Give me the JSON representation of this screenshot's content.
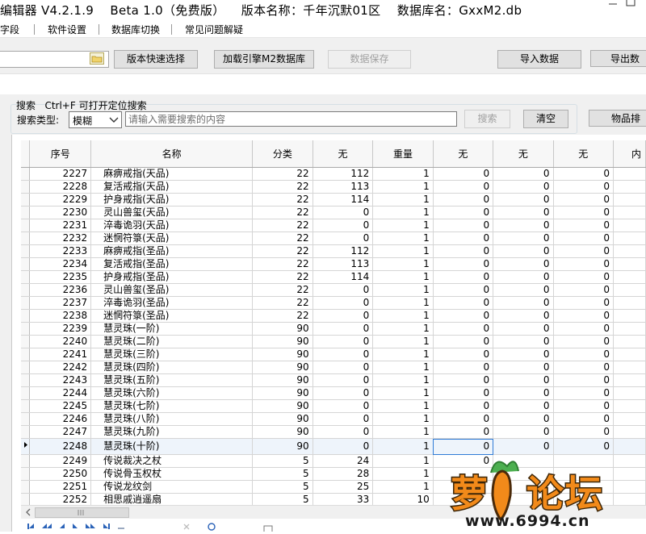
{
  "window": {
    "title": "编辑器 V4.2.1.9    Beta 1.0（免费版）    版本名称：千年沉默01区    数据库名：GxxM2.db"
  },
  "menu": [
    "字段",
    "软件设置",
    "数据库切换",
    "常见问题解疑"
  ],
  "toolbar": {
    "quick_select": "版本快速选择",
    "load_db": "加载引擎M2数据库",
    "save": "数据保存",
    "import": "导入数据",
    "export": "导出数"
  },
  "search": {
    "hint": "搜索   Ctrl+F 可打开定位搜索",
    "type_label": "搜索类型:",
    "type_value": "模糊",
    "placeholder": "请输入需要搜索的内容",
    "search_btn": "搜索",
    "clear_btn": "清空",
    "sort_btn": "物品排"
  },
  "grid": {
    "columns": [
      "序号",
      "名称",
      "分类",
      "无",
      "重量",
      "无",
      "无",
      "无",
      "内"
    ],
    "rows": [
      [
        "2227",
        "麻痹戒指(天品)",
        "22",
        "112",
        "1",
        "0",
        "0",
        "0"
      ],
      [
        "2228",
        "复活戒指(天品)",
        "22",
        "113",
        "1",
        "0",
        "0",
        "0"
      ],
      [
        "2229",
        "护身戒指(天品)",
        "22",
        "114",
        "1",
        "0",
        "0",
        "0"
      ],
      [
        "2230",
        "灵山兽玺(天品)",
        "22",
        "0",
        "1",
        "0",
        "0",
        "0"
      ],
      [
        "2231",
        "淬毒诡羽(天品)",
        "22",
        "0",
        "1",
        "0",
        "0",
        "0"
      ],
      [
        "2232",
        "迷惘符箓(天品)",
        "22",
        "0",
        "1",
        "0",
        "0",
        "0"
      ],
      [
        "2233",
        "麻痹戒指(圣品)",
        "22",
        "112",
        "1",
        "0",
        "0",
        "0"
      ],
      [
        "2234",
        "复活戒指(圣品)",
        "22",
        "113",
        "1",
        "0",
        "0",
        "0"
      ],
      [
        "2235",
        "护身戒指(圣品)",
        "22",
        "114",
        "1",
        "0",
        "0",
        "0"
      ],
      [
        "2236",
        "灵山兽玺(圣品)",
        "22",
        "0",
        "1",
        "0",
        "0",
        "0"
      ],
      [
        "2237",
        "淬毒诡羽(圣品)",
        "22",
        "0",
        "1",
        "0",
        "0",
        "0"
      ],
      [
        "2238",
        "迷惘符箓(圣品)",
        "22",
        "0",
        "1",
        "0",
        "0",
        "0"
      ],
      [
        "2239",
        "慧灵珠(一阶)",
        "90",
        "0",
        "1",
        "0",
        "0",
        "0"
      ],
      [
        "2240",
        "慧灵珠(二阶)",
        "90",
        "0",
        "1",
        "0",
        "0",
        "0"
      ],
      [
        "2241",
        "慧灵珠(三阶)",
        "90",
        "0",
        "1",
        "0",
        "0",
        "0"
      ],
      [
        "2242",
        "慧灵珠(四阶)",
        "90",
        "0",
        "1",
        "0",
        "0",
        "0"
      ],
      [
        "2243",
        "慧灵珠(五阶)",
        "90",
        "0",
        "1",
        "0",
        "0",
        "0"
      ],
      [
        "2244",
        "慧灵珠(六阶)",
        "90",
        "0",
        "1",
        "0",
        "0",
        "0"
      ],
      [
        "2245",
        "慧灵珠(七阶)",
        "90",
        "0",
        "1",
        "0",
        "0",
        "0"
      ],
      [
        "2246",
        "慧灵珠(八阶)",
        "90",
        "0",
        "1",
        "0",
        "0",
        "0"
      ],
      [
        "2247",
        "慧灵珠(九阶)",
        "90",
        "0",
        "1",
        "0",
        "0",
        "0"
      ],
      [
        "2248",
        "慧灵珠(十阶)",
        "90",
        "0",
        "1",
        "0",
        "0",
        "0"
      ],
      [
        "2249",
        "传说裁决之杖",
        "5",
        "24",
        "1",
        "0",
        "",
        ""
      ],
      [
        "2250",
        "传说骨玉权杖",
        "5",
        "28",
        "1",
        "",
        "",
        ""
      ],
      [
        "2251",
        "传说龙纹剑",
        "5",
        "25",
        "1",
        "",
        "",
        ""
      ],
      [
        "2252",
        "相思戚逍遥扇",
        "5",
        "33",
        "10",
        "",
        "",
        ""
      ]
    ],
    "current_row": 21
  },
  "watermark": {
    "brand": "萝卜论坛",
    "url": "www.6994.cn"
  },
  "colors": {
    "accent": "#2f7bd6",
    "watermark_orange": "#f28a1a"
  }
}
